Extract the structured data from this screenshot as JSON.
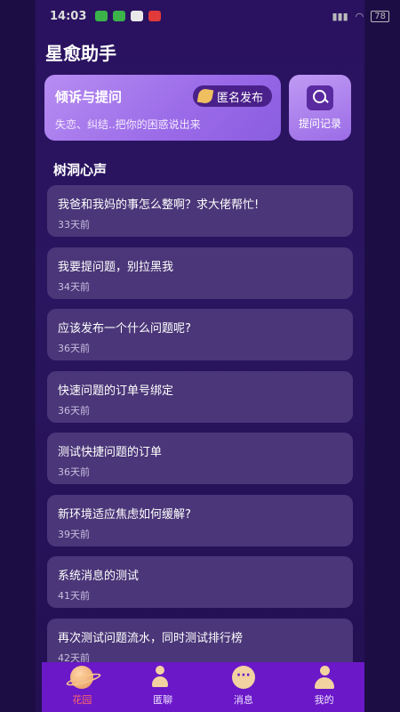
{
  "status_bar": {
    "time": "14:03",
    "battery": "78"
  },
  "app": {
    "title": "星愈助手"
  },
  "ask_card": {
    "title": "倾诉与提问",
    "subtitle": "失恋、纠结..把你的困惑说出来",
    "anon_label": "匿名发布"
  },
  "history": {
    "label": "提问记录"
  },
  "section": {
    "title": "树洞心声"
  },
  "posts": [
    {
      "title": "我爸和我妈的事怎么整啊？求大佬帮忙!",
      "time": "33天前"
    },
    {
      "title": "我要提问题，别拉黑我",
      "time": "34天前"
    },
    {
      "title": "应该发布一个什么问题呢?",
      "time": "36天前"
    },
    {
      "title": "快速问题的订单号绑定",
      "time": "36天前"
    },
    {
      "title": "测试快捷问题的订单",
      "time": "36天前"
    },
    {
      "title": "新环境适应焦虑如何缓解?",
      "time": "39天前"
    },
    {
      "title": "系统消息的测试",
      "time": "41天前"
    },
    {
      "title": "再次测试问题流水，同时测试排行榜",
      "time": "42天前"
    }
  ],
  "tabs": [
    {
      "label": "花园",
      "icon": "planet-icon"
    },
    {
      "label": "匿聊",
      "icon": "chat-users-icon"
    },
    {
      "label": "消息",
      "icon": "message-icon"
    },
    {
      "label": "我的",
      "icon": "profile-icon"
    }
  ],
  "colors": {
    "background": "#2a1260",
    "card": "#4a3678",
    "accent": "#9a6ae8",
    "tabbar": "#6a18c8",
    "active_tab": "#ff6a6a"
  }
}
